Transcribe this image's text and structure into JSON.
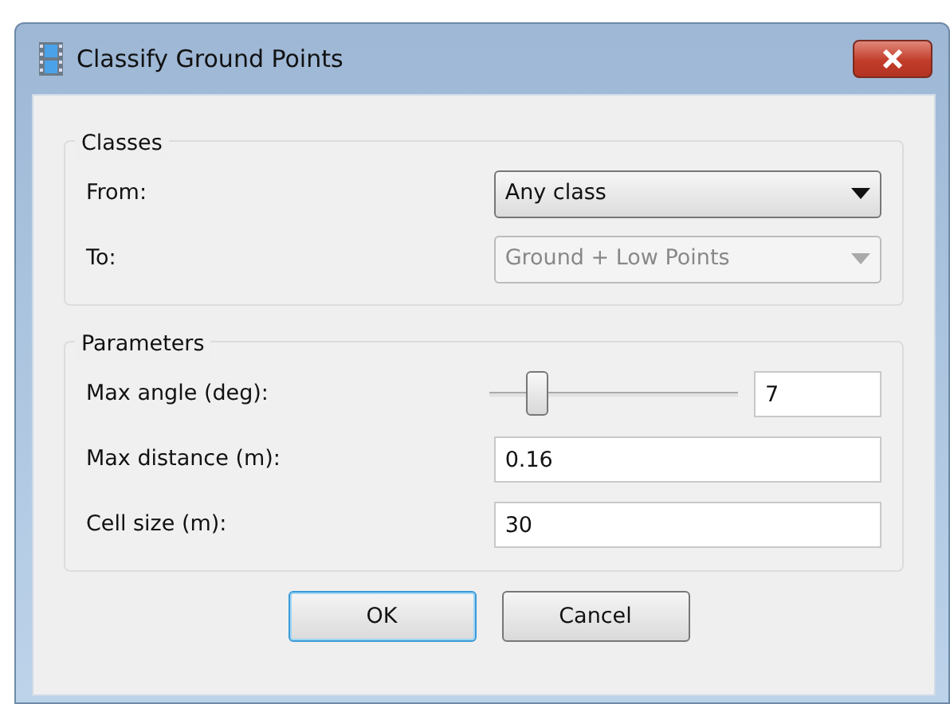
{
  "window": {
    "title": "Classify Ground Points"
  },
  "classes": {
    "legend": "Classes",
    "rows": [
      {
        "label": "From:",
        "value": "Any class",
        "disabled": false
      },
      {
        "label": "To:",
        "value": "Ground + Low Points",
        "disabled": true
      }
    ]
  },
  "parameters": {
    "legend": "Parameters",
    "rows": [
      {
        "kind": "slider",
        "label": "Max angle (deg):",
        "level": 0.19,
        "value": "7"
      },
      {
        "kind": "text",
        "label": "Max distance (m):",
        "value": "0.16"
      },
      {
        "kind": "text",
        "label": "Cell size (m):",
        "value": "30"
      }
    ]
  },
  "buttons": [
    {
      "label": "OK",
      "default": true
    },
    {
      "label": "Cancel",
      "default": false
    }
  ]
}
